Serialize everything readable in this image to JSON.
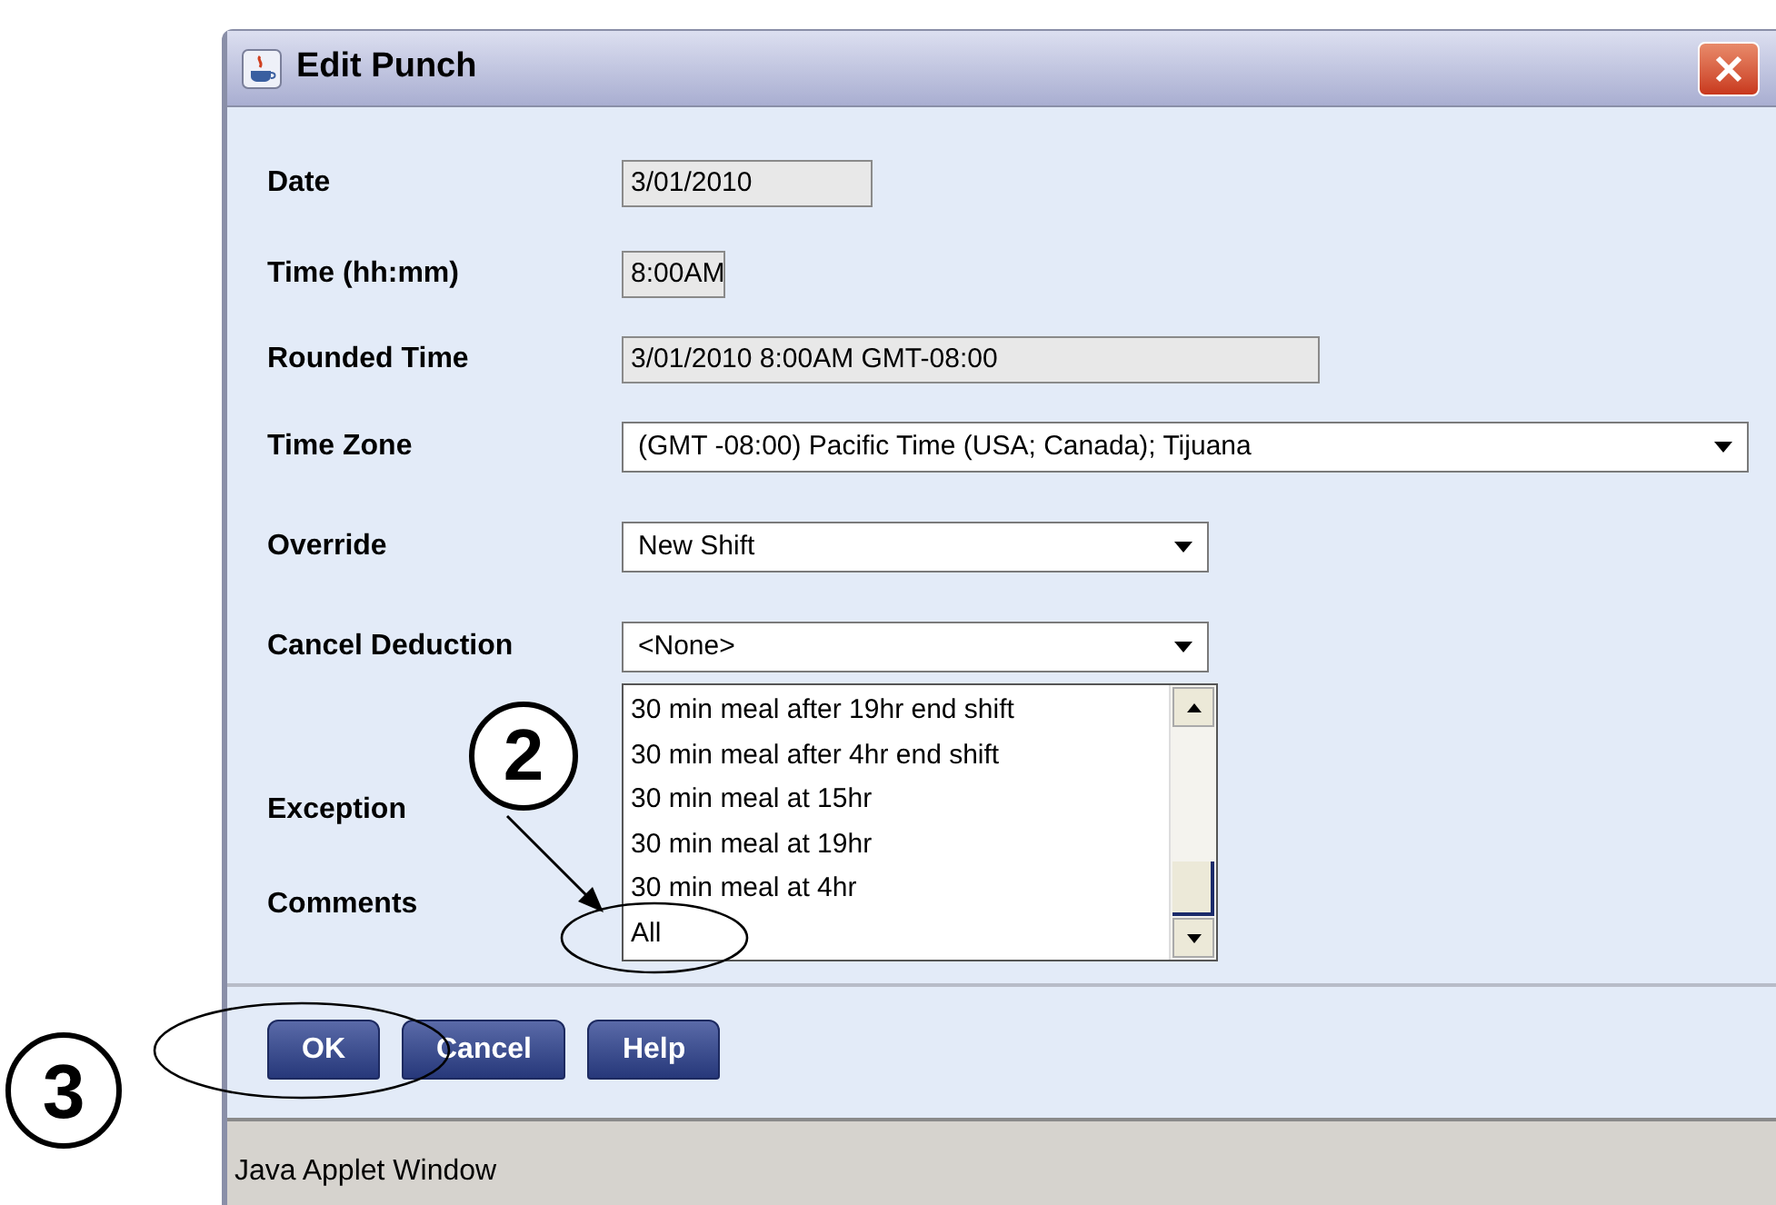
{
  "window": {
    "title": "Edit Punch"
  },
  "fields": [
    {
      "kind": "text",
      "label": "Date",
      "value": "3/01/2010"
    },
    {
      "kind": "text",
      "label": "Time (hh:mm)",
      "value": "8:00AM"
    },
    {
      "kind": "text",
      "label": "Rounded Time",
      "value": "3/01/2010 8:00AM GMT-08:00"
    },
    {
      "kind": "select",
      "label": "Time Zone",
      "value": "(GMT -08:00) Pacific Time (USA; Canada); Tijuana"
    },
    {
      "kind": "select",
      "label": "Override",
      "value": "New Shift"
    },
    {
      "kind": "select",
      "label": "Cancel Deduction",
      "value": "<None>"
    }
  ],
  "dropdown_list": [
    "30 min meal after 19hr end shift",
    "30 min meal after 4hr end shift",
    "30 min meal at 15hr",
    "30 min meal at 19hr",
    "30 min meal at 4hr",
    "All"
  ],
  "side_labels": [
    "Exception",
    "Comments"
  ],
  "buttons": [
    "OK",
    "Cancel",
    "Help"
  ],
  "status_bar": "Java Applet Window",
  "callouts": [
    "2",
    "3"
  ]
}
